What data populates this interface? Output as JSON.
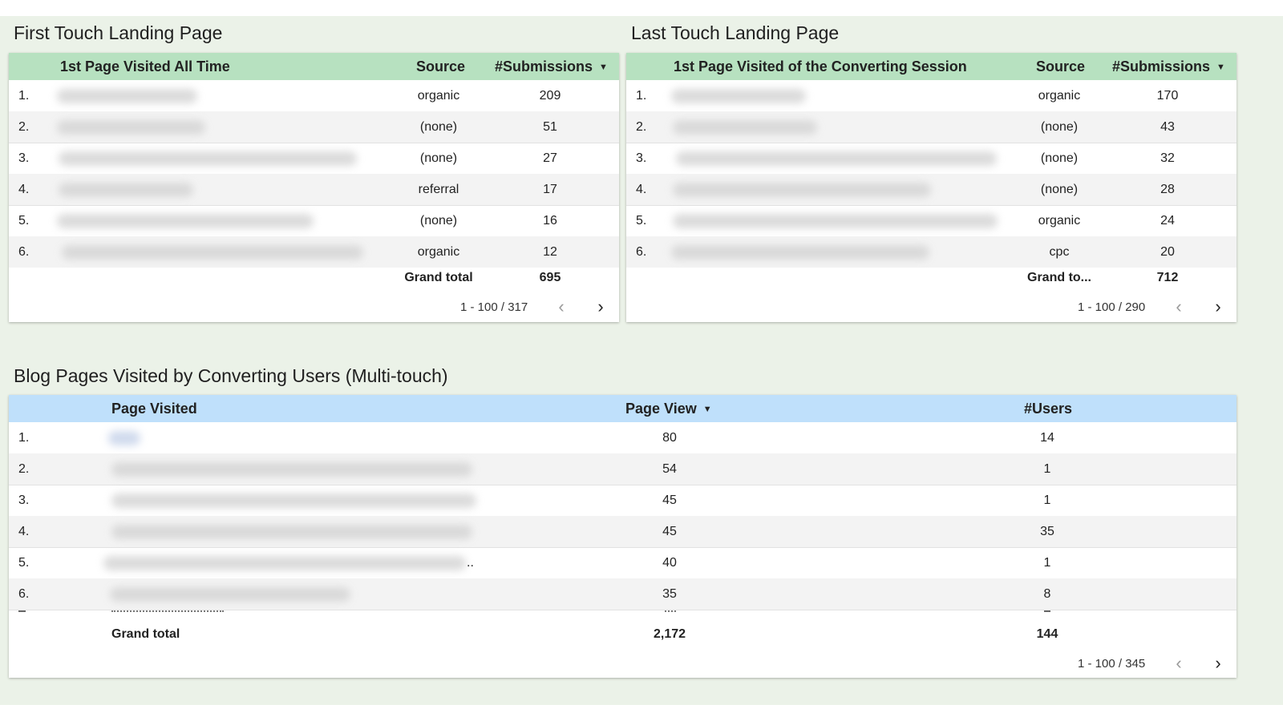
{
  "first_touch": {
    "title": "First Touch Landing Page",
    "columns": {
      "page": "1st Page Visited All Time",
      "source": "Source",
      "submissions": "#Submissions"
    },
    "rows": [
      {
        "num": "1.",
        "source": "organic",
        "submissions": "209"
      },
      {
        "num": "2.",
        "source": "(none)",
        "submissions": "51"
      },
      {
        "num": "3.",
        "source": "(none)",
        "submissions": "27"
      },
      {
        "num": "4.",
        "source": "referral",
        "submissions": "17"
      },
      {
        "num": "5.",
        "source": "(none)",
        "submissions": "16"
      },
      {
        "num": "6.",
        "source": "organic",
        "submissions": "12"
      }
    ],
    "grand_total_label": "Grand total",
    "grand_total_value": "695",
    "pagination": "1 - 100 / 317"
  },
  "last_touch": {
    "title": "Last Touch Landing Page",
    "columns": {
      "page": "1st Page Visited of the Converting Session",
      "source": "Source",
      "submissions": "#Submissions"
    },
    "rows": [
      {
        "num": "1.",
        "source": "organic",
        "submissions": "170"
      },
      {
        "num": "2.",
        "source": "(none)",
        "submissions": "43"
      },
      {
        "num": "3.",
        "source": "(none)",
        "submissions": "32"
      },
      {
        "num": "4.",
        "source": "(none)",
        "submissions": "28"
      },
      {
        "num": "5.",
        "source": "organic",
        "submissions": "24"
      },
      {
        "num": "6.",
        "source": "cpc",
        "submissions": "20"
      }
    ],
    "grand_total_label": "Grand to...",
    "grand_total_value": "712",
    "pagination": "1 - 100 / 290"
  },
  "blog": {
    "title": "Blog Pages Visited by Converting Users (Multi-touch)",
    "columns": {
      "page": "Page Visited",
      "page_view": "Page View",
      "users": "#Users"
    },
    "rows": [
      {
        "num": "1.",
        "page_view": "80",
        "users": "14"
      },
      {
        "num": "2.",
        "page_view": "54",
        "users": "1"
      },
      {
        "num": "3.",
        "page_view": "45",
        "users": "1"
      },
      {
        "num": "4.",
        "page_view": "45",
        "users": "35"
      },
      {
        "num": "5.",
        "page_view": "40",
        "users": "1"
      },
      {
        "num": "6.",
        "page_view": "35",
        "users": "8"
      }
    ],
    "row5_ellipsis": "..",
    "grand_total_label": "Grand total",
    "grand_total_page_view": "2,172",
    "grand_total_users": "144",
    "pagination": "1 - 100 / 345"
  },
  "icons": {
    "sort": "▼",
    "prev": "‹",
    "next": "›"
  },
  "colors": {
    "landing_header": "#b7e1c0",
    "blog_header": "#bfe0fb",
    "dashboard_bg": "#ebf2e8"
  }
}
